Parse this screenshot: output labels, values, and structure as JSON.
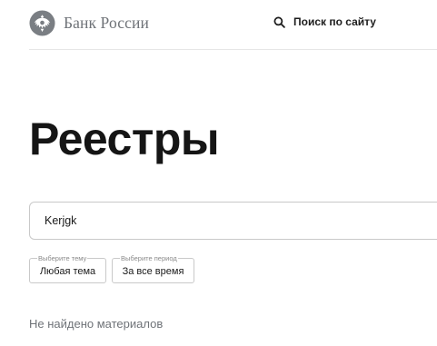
{
  "header": {
    "logo_text": "Банк России",
    "search_label": "Поиск по сайту"
  },
  "page": {
    "title": "Реестры"
  },
  "search": {
    "query_value": "Kerjgk"
  },
  "filters": [
    {
      "legend": "Выберите тему",
      "value": "Любая тема"
    },
    {
      "legend": "Выберите период",
      "value": "За все время"
    }
  ],
  "results": {
    "empty_message": "Не найдено материалов"
  },
  "colors": {
    "logo_gray": "#6f7378",
    "text_dark": "#151515",
    "border": "#c9c9c9"
  }
}
